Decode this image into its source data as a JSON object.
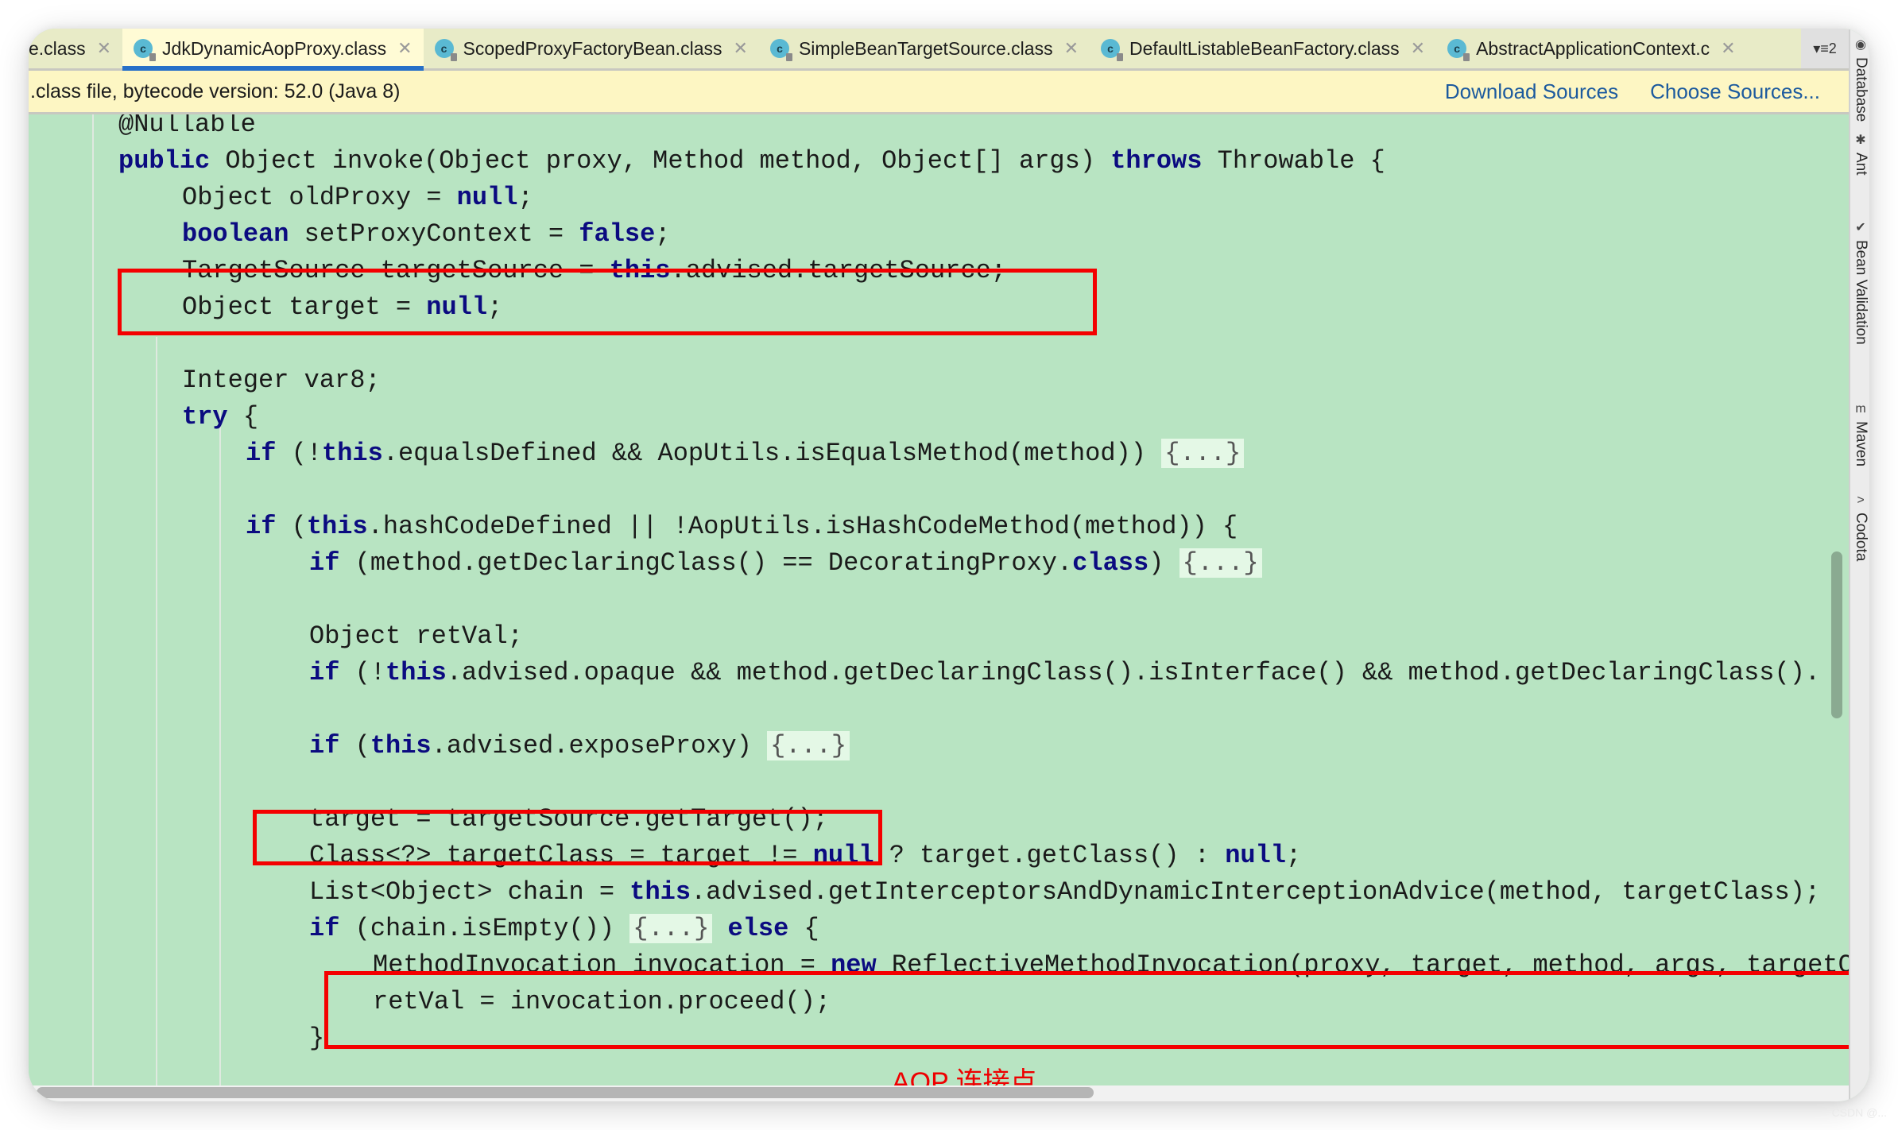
{
  "tabs": [
    {
      "label": "e.class",
      "icon": "class-icon",
      "active": false
    },
    {
      "label": "JdkDynamicAopProxy.class",
      "icon": "class-icon",
      "active": true
    },
    {
      "label": "ScopedProxyFactoryBean.class",
      "icon": "class-icon",
      "active": false
    },
    {
      "label": "SimpleBeanTargetSource.class",
      "icon": "class-icon",
      "active": false
    },
    {
      "label": "DefaultListableBeanFactory.class",
      "icon": "class-icon",
      "active": false
    },
    {
      "label": "AbstractApplicationContext.c",
      "icon": "class-icon",
      "active": false
    }
  ],
  "tab_close_glyph": "✕",
  "tab_class_glyph": "c",
  "tab_overflow": {
    "label": "▾≡2",
    "count": "2"
  },
  "infobar": {
    "message": ".class file, bytecode version: 52.0 (Java 8)",
    "download_sources": "Download Sources",
    "choose_sources": "Choose Sources..."
  },
  "sidebar": [
    {
      "label": "Database",
      "icon": "database-icon",
      "glyph": "◉"
    },
    {
      "label": "Ant",
      "icon": "ant-icon",
      "glyph": "✱"
    },
    {
      "label": "Bean Validation",
      "icon": "bean-validation-icon",
      "glyph": "✔"
    },
    {
      "label": "Maven",
      "icon": "maven-icon",
      "glyph": "m"
    },
    {
      "label": "Codota",
      "icon": "codota-icon",
      "glyph": ">"
    }
  ],
  "code_lines": [
    {
      "indent": 1,
      "tokens": [
        {
          "t": "@Nullable"
        }
      ]
    },
    {
      "indent": 1,
      "tokens": [
        {
          "t": "public",
          "k": 1
        },
        {
          "t": " Object invoke(Object proxy, Method method, Object[] args) "
        },
        {
          "t": "throws",
          "k": 1
        },
        {
          "t": " Throwable {"
        }
      ]
    },
    {
      "indent": 2,
      "tokens": [
        {
          "t": "Object oldProxy = "
        },
        {
          "t": "null",
          "k": 1
        },
        {
          "t": ";"
        }
      ]
    },
    {
      "indent": 2,
      "tokens": [
        {
          "t": "boolean",
          "k": 1
        },
        {
          "t": " setProxyContext = "
        },
        {
          "t": "false",
          "k": 1
        },
        {
          "t": ";"
        }
      ]
    },
    {
      "indent": 2,
      "tokens": [
        {
          "t": "TargetSource targetSource = "
        },
        {
          "t": "this",
          "k": 1
        },
        {
          "t": ".advised.targetSource;"
        }
      ]
    },
    {
      "indent": 2,
      "tokens": [
        {
          "t": "Object target = "
        },
        {
          "t": "null",
          "k": 1
        },
        {
          "t": ";"
        }
      ]
    },
    {
      "indent": 0,
      "tokens": []
    },
    {
      "indent": 2,
      "tokens": [
        {
          "t": "Integer var8;"
        }
      ]
    },
    {
      "indent": 2,
      "tokens": [
        {
          "t": "try",
          "k": 1
        },
        {
          "t": " {"
        }
      ]
    },
    {
      "indent": 3,
      "tokens": [
        {
          "t": "if",
          "k": 1
        },
        {
          "t": " (!"
        },
        {
          "t": "this",
          "k": 1
        },
        {
          "t": ".equalsDefined && AopUtils.isEqualsMethod(method)) "
        },
        {
          "t": "{...}",
          "f": 1
        }
      ]
    },
    {
      "indent": 0,
      "tokens": []
    },
    {
      "indent": 3,
      "tokens": [
        {
          "t": "if",
          "k": 1
        },
        {
          "t": " ("
        },
        {
          "t": "this",
          "k": 1
        },
        {
          "t": ".hashCodeDefined || !AopUtils.isHashCodeMethod(method)) {"
        }
      ]
    },
    {
      "indent": 4,
      "tokens": [
        {
          "t": "if",
          "k": 1
        },
        {
          "t": " (method.getDeclaringClass() == DecoratingProxy."
        },
        {
          "t": "class",
          "k": 1
        },
        {
          "t": ") "
        },
        {
          "t": "{...}",
          "f": 1
        }
      ]
    },
    {
      "indent": 0,
      "tokens": []
    },
    {
      "indent": 4,
      "tokens": [
        {
          "t": "Object retVal;"
        }
      ]
    },
    {
      "indent": 4,
      "tokens": [
        {
          "t": "if",
          "k": 1
        },
        {
          "t": " (!"
        },
        {
          "t": "this",
          "k": 1
        },
        {
          "t": ".advised.opaque && method.getDeclaringClass().isInterface() && method.getDeclaringClass()."
        }
      ]
    },
    {
      "indent": 0,
      "tokens": []
    },
    {
      "indent": 4,
      "tokens": [
        {
          "t": "if",
          "k": 1
        },
        {
          "t": " ("
        },
        {
          "t": "this",
          "k": 1
        },
        {
          "t": ".advised.exposeProxy) "
        },
        {
          "t": "{...}",
          "f": 1
        }
      ]
    },
    {
      "indent": 0,
      "tokens": []
    },
    {
      "indent": 4,
      "tokens": [
        {
          "t": "target = targetSource.getTarget();"
        }
      ]
    },
    {
      "indent": 4,
      "tokens": [
        {
          "t": "Class<?> targetClass = target != "
        },
        {
          "t": "null",
          "k": 1
        },
        {
          "t": " ? target.getClass() : "
        },
        {
          "t": "null",
          "k": 1
        },
        {
          "t": ";"
        }
      ]
    },
    {
      "indent": 4,
      "tokens": [
        {
          "t": "List<Object> chain = "
        },
        {
          "t": "this",
          "k": 1
        },
        {
          "t": ".advised.getInterceptorsAndDynamicInterceptionAdvice(method, targetClass);"
        }
      ]
    },
    {
      "indent": 4,
      "tokens": [
        {
          "t": "if",
          "k": 1
        },
        {
          "t": " (chain.isEmpty()) "
        },
        {
          "t": "{...}",
          "f": 1
        },
        {
          "t": " "
        },
        {
          "t": "else",
          "k": 1
        },
        {
          "t": " {"
        }
      ]
    },
    {
      "indent": 5,
      "tokens": [
        {
          "t": "MethodInvocation invocation = "
        },
        {
          "t": "new",
          "k": 1
        },
        {
          "t": " ReflectiveMethodInvocation(proxy, target, method, args, targetClass, chain);"
        }
      ]
    },
    {
      "indent": 5,
      "tokens": [
        {
          "t": "retVal = invocation.proceed();"
        }
      ]
    },
    {
      "indent": 4,
      "tokens": [
        {
          "t": "}"
        }
      ]
    }
  ],
  "annotation": {
    "caption": "AOP 连接点",
    "color": "#ee0000"
  },
  "colors": {
    "editor_bg": "#b8e4c2",
    "keyword": "#0b0b80",
    "highlight_box": "#f40000",
    "link": "#1c5a9e",
    "active_tab_underline": "#2770c8"
  },
  "watermark": "CSDN @..."
}
